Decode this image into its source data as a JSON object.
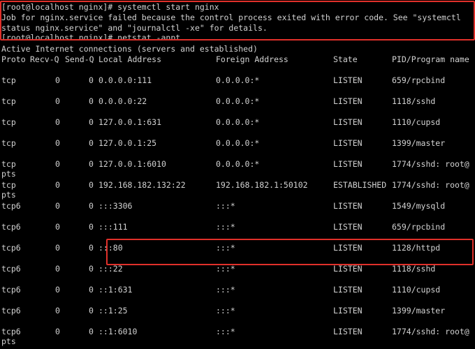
{
  "terminal": {
    "prompt1": "[root@localhost nginx]# systemctl start nginx",
    "error_line1": "Job for nginx.service failed because the control process exited with error code. See \"systemctl",
    "error_line2": "status nginx.service\" and \"journalctl -xe\" for details.",
    "prompt2": "[root@localhost nginx]# netstat -anpt",
    "header_title": "Active Internet connections (servers and established)",
    "columns": [
      "Proto",
      "Recv-Q",
      "Send-Q",
      "Local Address",
      "Foreign Address",
      "State",
      "PID/Program name"
    ],
    "rows": [
      {
        "proto": "tcp",
        "recv": "0",
        "send": "0",
        "local": "0.0.0.0:111",
        "foreign": "0.0.0.0:*",
        "state": "LISTEN",
        "pid": "659/rpcbind",
        "wrap": ""
      },
      {
        "proto": "tcp",
        "recv": "0",
        "send": "0",
        "local": "0.0.0.0:22",
        "foreign": "0.0.0.0:*",
        "state": "LISTEN",
        "pid": "1118/sshd",
        "wrap": ""
      },
      {
        "proto": "tcp",
        "recv": "0",
        "send": "0",
        "local": "127.0.0.1:631",
        "foreign": "0.0.0.0:*",
        "state": "LISTEN",
        "pid": "1110/cupsd",
        "wrap": ""
      },
      {
        "proto": "tcp",
        "recv": "0",
        "send": "0",
        "local": "127.0.0.1:25",
        "foreign": "0.0.0.0:*",
        "state": "LISTEN",
        "pid": "1399/master",
        "wrap": ""
      },
      {
        "proto": "tcp",
        "recv": "0",
        "send": "0",
        "local": "127.0.0.1:6010",
        "foreign": "0.0.0.0:*",
        "state": "LISTEN",
        "pid": "1774/sshd: root@",
        "wrap": "pts"
      },
      {
        "proto": "tcp",
        "recv": "0",
        "send": "0",
        "local": "192.168.182.132:22",
        "foreign": "192.168.182.1:50102",
        "state": "ESTABLISHED",
        "pid": "1774/sshd: root@",
        "wrap": "pts"
      },
      {
        "proto": "tcp6",
        "recv": "0",
        "send": "0",
        "local": ":::3306",
        "foreign": ":::*",
        "state": "LISTEN",
        "pid": "1549/mysqld",
        "wrap": ""
      },
      {
        "proto": "tcp6",
        "recv": "0",
        "send": "0",
        "local": ":::111",
        "foreign": ":::*",
        "state": "LISTEN",
        "pid": "659/rpcbind",
        "wrap": ""
      },
      {
        "proto": "tcp6",
        "recv": "0",
        "send": "0",
        "local": ":::80",
        "foreign": ":::*",
        "state": "LISTEN",
        "pid": "1128/httpd",
        "wrap": ""
      },
      {
        "proto": "tcp6",
        "recv": "0",
        "send": "0",
        "local": ":::22",
        "foreign": ":::*",
        "state": "LISTEN",
        "pid": "1118/sshd",
        "wrap": ""
      },
      {
        "proto": "tcp6",
        "recv": "0",
        "send": "0",
        "local": "::1:631",
        "foreign": ":::*",
        "state": "LISTEN",
        "pid": "1110/cupsd",
        "wrap": ""
      },
      {
        "proto": "tcp6",
        "recv": "0",
        "send": "0",
        "local": "::1:25",
        "foreign": ":::*",
        "state": "LISTEN",
        "pid": "1399/master",
        "wrap": ""
      },
      {
        "proto": "tcp6",
        "recv": "0",
        "send": "0",
        "local": "::1:6010",
        "foreign": ":::*",
        "state": "LISTEN",
        "pid": "1774/sshd: root@",
        "wrap": "pts"
      }
    ]
  },
  "colors": {
    "background": "#000000",
    "text": "#d2d2d2",
    "highlight": "#e0302a"
  }
}
